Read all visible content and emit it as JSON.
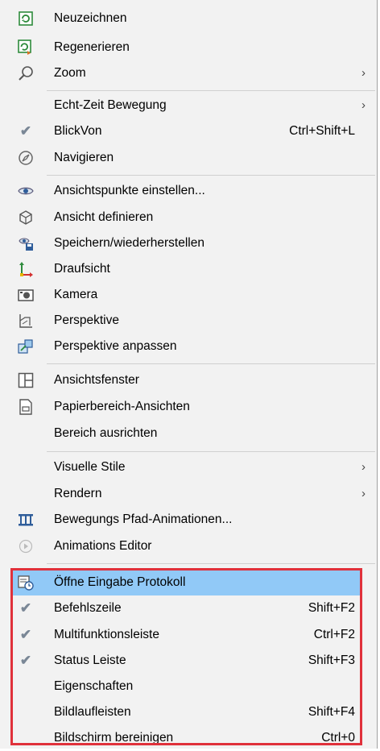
{
  "menu": {
    "items": [
      {
        "label": "Neuzeichnen",
        "icon": "redraw-icon"
      },
      {
        "label": "Regenerieren",
        "icon": "regen-icon"
      },
      {
        "label": "Zoom",
        "icon": "zoom-icon",
        "submenu": "›"
      },
      {
        "label": "Echt-Zeit Bewegung",
        "submenu": "›"
      },
      {
        "label": "BlickVon",
        "shortcut": "Ctrl+Shift+L",
        "icon": "check-icon"
      },
      {
        "label": "Navigieren",
        "icon": "compass-icon"
      },
      {
        "label": "Ansichtspunkte einstellen...",
        "icon": "eye-icon"
      },
      {
        "label": "Ansicht definieren",
        "icon": "cube-icon"
      },
      {
        "label": "Speichern/wiederherstellen",
        "icon": "save-view-icon"
      },
      {
        "label": "Draufsicht",
        "icon": "plan-view-icon"
      },
      {
        "label": "Kamera",
        "icon": "camera-icon"
      },
      {
        "label": "Perspektive",
        "icon": "perspective-icon"
      },
      {
        "label": "Perspektive anpassen",
        "icon": "adjust-perspective-icon"
      },
      {
        "label": "Ansichtsfenster",
        "icon": "viewport-icon"
      },
      {
        "label": "Papierbereich-Ansichten",
        "icon": "paper-icon"
      },
      {
        "label": "Bereich ausrichten"
      },
      {
        "label": "Visuelle Stile",
        "submenu": "›"
      },
      {
        "label": "Rendern",
        "submenu": "›"
      },
      {
        "label": "Bewegungs Pfad-Animationen...",
        "icon": "path-animation-icon"
      },
      {
        "label": "Animations Editor",
        "icon": "play-icon"
      },
      {
        "label": "Öffne Eingabe Protokoll",
        "icon": "history-icon"
      },
      {
        "label": "Befehlszeile",
        "shortcut": "Shift+F2",
        "icon": "check-icon"
      },
      {
        "label": "Multifunktionsleiste",
        "shortcut": "Ctrl+F2",
        "icon": "check-icon"
      },
      {
        "label": "Status Leiste",
        "shortcut": "Shift+F3",
        "icon": "check-icon"
      },
      {
        "label": "Eigenschaften"
      },
      {
        "label": "Bildlaufleisten",
        "shortcut": "Shift+F4"
      },
      {
        "label": "Bildschirm bereinigen",
        "shortcut": "Ctrl+0"
      }
    ]
  },
  "colors": {
    "highlight": "#91c9f7",
    "annotation_box": "#e0313b"
  }
}
